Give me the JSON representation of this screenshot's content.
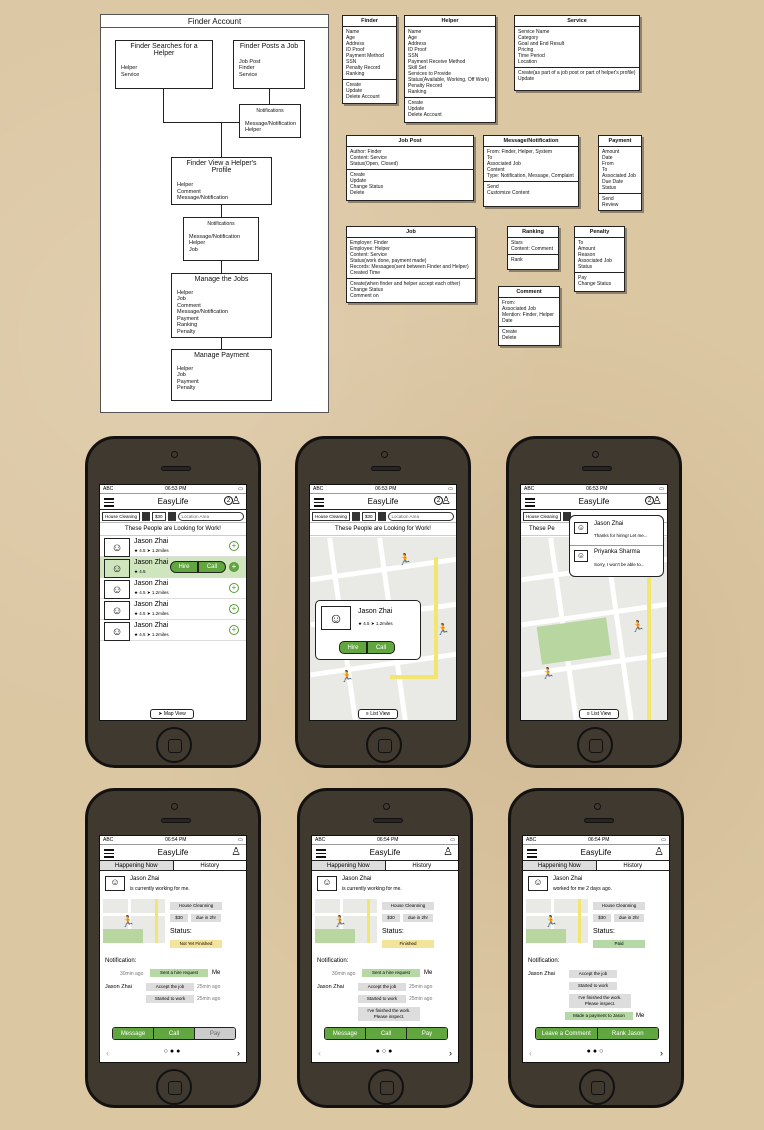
{
  "flow": {
    "title": "Finder Account",
    "box1": {
      "title": "Finder Searches for a Helper",
      "items": [
        "Helper",
        "Service"
      ]
    },
    "box2": {
      "title": "Finder Posts a Job",
      "items": [
        "Job Post",
        "Finder",
        "Service"
      ]
    },
    "box3": {
      "title": "Notifications",
      "items": [
        "Message/Notification",
        "Helper"
      ]
    },
    "box4": {
      "title": "Finder View a Helper's Profile",
      "items": [
        "Helper",
        "Comment",
        "Message/Notification"
      ]
    },
    "box5": {
      "title": "Notifications",
      "items": [
        "Message/Notification",
        "Helper",
        "Job"
      ]
    },
    "box6": {
      "title": "Manage the Jobs",
      "items": [
        "Helper",
        "Job",
        "Comment",
        "Message/Notification",
        "Payment",
        "Ranking",
        "Penalty"
      ]
    },
    "box7": {
      "title": "Manage Payment",
      "items": [
        "Helper",
        "Job",
        "Payment",
        "Penalty"
      ]
    }
  },
  "entities": {
    "finder": {
      "title": "Finder",
      "fields": [
        "Name",
        "Age",
        "Address",
        "ID Proof",
        "Payment Method",
        "SSN",
        "Penalty Record",
        "Ranking"
      ],
      "ops": [
        "Create",
        "Update",
        "Delete Account"
      ]
    },
    "helper": {
      "title": "Helper",
      "fields": [
        "Name",
        "Age",
        "Address",
        "ID Proof",
        "SSN",
        "Payment Receive Method",
        "Skill Set",
        "Services to Provide",
        "Status(Available, Working, Off Work)",
        "Penalty Record",
        "Ranking"
      ],
      "ops": [
        "Create",
        "Update",
        "Delete Account"
      ]
    },
    "service": {
      "title": "Service",
      "fields": [
        "Service Name",
        "Category",
        "Goal and End Result",
        "Pricing",
        "Time Period",
        "Location"
      ],
      "ops": [
        "Create(as part of a job post or part of helper's profile)",
        "Update"
      ]
    },
    "jobpost": {
      "title": "Job Post",
      "fields": [
        "Author: Finder",
        "Content: Service",
        "Status(Open, Closed)"
      ],
      "ops": [
        "Create",
        "Update",
        "Change Status",
        "Delete"
      ]
    },
    "message": {
      "title": "Message/Notification",
      "fields": [
        "From: Finder, Helper, System",
        "To",
        "Associated Job",
        "Content",
        "Type: Notification, Message, Complaint"
      ],
      "ops": [
        "Send",
        "Customize Content"
      ]
    },
    "payment": {
      "title": "Payment",
      "fields": [
        "Amount",
        "Date",
        "From",
        "To",
        "Associated Job",
        "Due Date",
        "Status"
      ],
      "ops": [
        "Send",
        "Review"
      ]
    },
    "job": {
      "title": "Job",
      "fields": [
        "Employer: Finder",
        "Employee: Helper",
        "Content: Service",
        "Status(work done, payment made)",
        "Records: Messages(sent between Finder and Helper)",
        "Created Time"
      ],
      "ops": [
        "Create(when finder and helper accept each other)",
        "Change Status",
        "Comment on"
      ]
    },
    "ranking": {
      "title": "Ranking",
      "fields": [
        "Stars",
        "Content: Comment"
      ],
      "ops": [
        "Rank"
      ]
    },
    "penalty": {
      "title": "Penalty",
      "fields": [
        "To",
        "Amount",
        "Reason",
        "Associated Job",
        "Status"
      ],
      "ops": [
        "Pay",
        "Change Status"
      ]
    },
    "comment": {
      "title": "Comment",
      "fields": [
        "From:",
        "Associated Job",
        "Mention: Finder, Helper",
        "Date"
      ],
      "ops": [
        "Create",
        "Delete"
      ]
    }
  },
  "app": {
    "carrier": "ABC",
    "time1": "06:53 PM",
    "time2": "06:54 PM",
    "name": "EasyLife",
    "filter_service": "House Cleaning",
    "filter_price": "$30",
    "search_placeholder": "Location Area",
    "subtitle": "These People are Looking for Work!",
    "badge_count": "2",
    "person": "Jason Zhai",
    "rating": "4.5",
    "distance": "1.2miles",
    "hire": "Hire",
    "call": "Call",
    "map_view": "Map View",
    "list_view": "List View",
    "msg1_name": "Jason Zhai",
    "msg1_text": "Thanks for hiring! Let me...",
    "msg2_name": "Priyanka Sharma",
    "msg2_text": "Sorry, I won't be able to...",
    "tab_now": "Happening Now",
    "tab_history": "History",
    "working_for": "is currently working for me.",
    "worked_for": "worked for me 2 days ago.",
    "job_service": "House Cleanning",
    "job_price": "$30",
    "job_due": "due in 2hr",
    "status_label": "Status:",
    "status1": "Not Yet Finished",
    "status2": "Finished",
    "status3": "Paid",
    "notification": "Notification:",
    "t30": "30min ago",
    "t25": "25min ago",
    "sent_hire": "Sent a hire request",
    "me": "Me",
    "accept": "Accept the job",
    "started": "Started to work",
    "finished_work": "I've finished the work. Please inspect.",
    "made_payment": "Made a payment to Jason",
    "btn_message": "Message",
    "btn_call": "Call",
    "btn_pay": "Pay",
    "btn_comment": "Leave a Comment",
    "btn_rank": "Rank Jason"
  }
}
